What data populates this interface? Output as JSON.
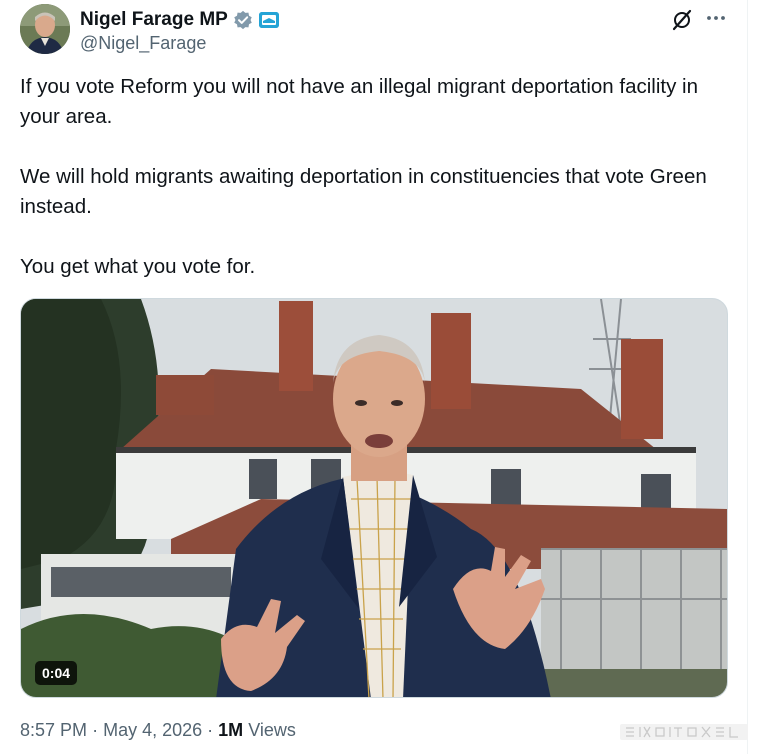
{
  "author": {
    "display_name": "Nigel Farage MP",
    "handle": "@Nigel_Farage"
  },
  "tweet": {
    "paragraphs": [
      "If you vote Reform you will not have an illegal migrant deportation facility in your area.",
      "We will hold migrants awaiting deportation in constituencies that vote Green instead.",
      "You get what you vote for."
    ]
  },
  "media": {
    "duration": "0:04"
  },
  "meta": {
    "time": "8:57 PM",
    "separator": "·",
    "date": "May 4, 2026",
    "views_count": "1M",
    "views_label": "Views"
  },
  "colors": {
    "text": "#0f1419",
    "secondary": "#536471",
    "verified": "#829aab",
    "border": "#cfd9de"
  },
  "icons": [
    "verified-badge-icon",
    "affiliation-badge-icon",
    "grok-icon",
    "more-icon"
  ]
}
